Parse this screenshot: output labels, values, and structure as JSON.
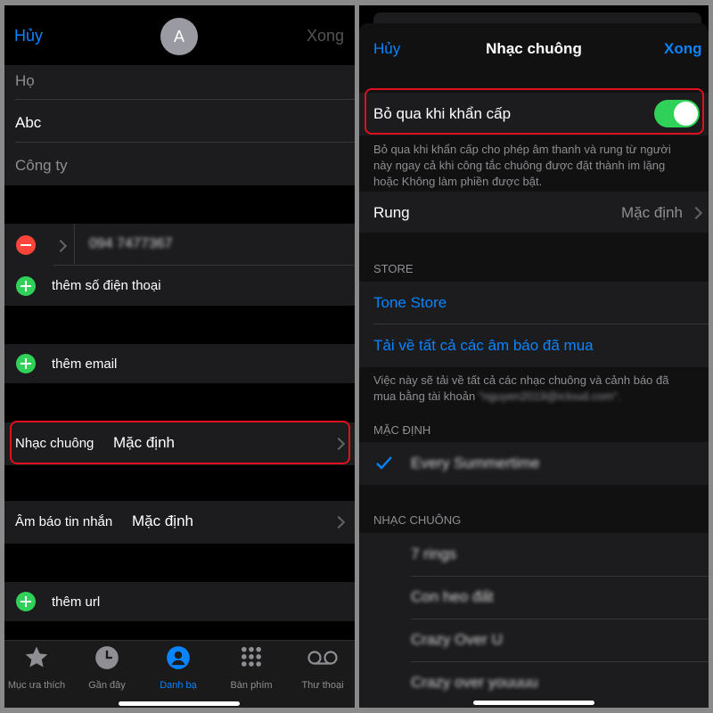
{
  "left": {
    "nav": {
      "cancel": "Hủy",
      "avatar_initial": "A",
      "done": "Xong"
    },
    "fields": {
      "last_name_placeholder": "Họ",
      "first_name": "Abc",
      "company_placeholder": "Công ty"
    },
    "phone": {
      "number": "094 7477367",
      "add_label": "thêm số điện thoại"
    },
    "email": {
      "add_label": "thêm email"
    },
    "ringtone": {
      "label": "Nhạc chuông",
      "value": "Mặc định"
    },
    "text_tone": {
      "label": "Âm báo tin nhắn",
      "value": "Mặc định"
    },
    "url": {
      "add_label": "thêm url"
    },
    "tabbar": [
      {
        "label": "Mục ưa thích",
        "icon": "star-icon"
      },
      {
        "label": "Gần đây",
        "icon": "clock-icon"
      },
      {
        "label": "Danh bạ",
        "icon": "contacts-icon"
      },
      {
        "label": "Bàn phím",
        "icon": "keypad-icon"
      },
      {
        "label": "Thư thoại",
        "icon": "voicemail-icon"
      }
    ],
    "colors": {
      "accent": "#0a84ff",
      "add": "#30d158",
      "remove": "#ff453a"
    }
  },
  "right": {
    "nav": {
      "cancel": "Hủy",
      "title": "Nhạc chuông",
      "done": "Xong"
    },
    "emergency": {
      "label": "Bỏ qua khi khẩn cấp",
      "on": true,
      "description_line1": "Bỏ qua khi khẩn cấp cho phép âm thanh và rung từ người",
      "description_line2": "này ngay cả khi công tắc chuông được đặt thành im lặng",
      "description_line3": "hoặc Không làm phiền được bật."
    },
    "vibration": {
      "label": "Rung",
      "value": "Mặc định"
    },
    "store": {
      "header": "STORE",
      "tone_store": "Tone Store",
      "download_all": "Tải về tất cả các âm báo đã mua",
      "note_line1": "Việc này sẽ tải về tất cả các nhạc chuông và cảnh báo đã",
      "note_line2_prefix": "mua bằng tài khoản",
      "account": "\"nguyen2019@icloud.com\"."
    },
    "default_section": {
      "header": "MẶC ĐỊNH",
      "selected": "Every Summertime"
    },
    "ringtones_section": {
      "header": "NHẠC CHUÔNG",
      "items": [
        "7 rings",
        "Con heo đất",
        "Crazy Over U",
        "Crazy over youuuu"
      ]
    },
    "colors": {
      "toggle_on": "#30d158",
      "highlight": "#e0101e"
    }
  }
}
